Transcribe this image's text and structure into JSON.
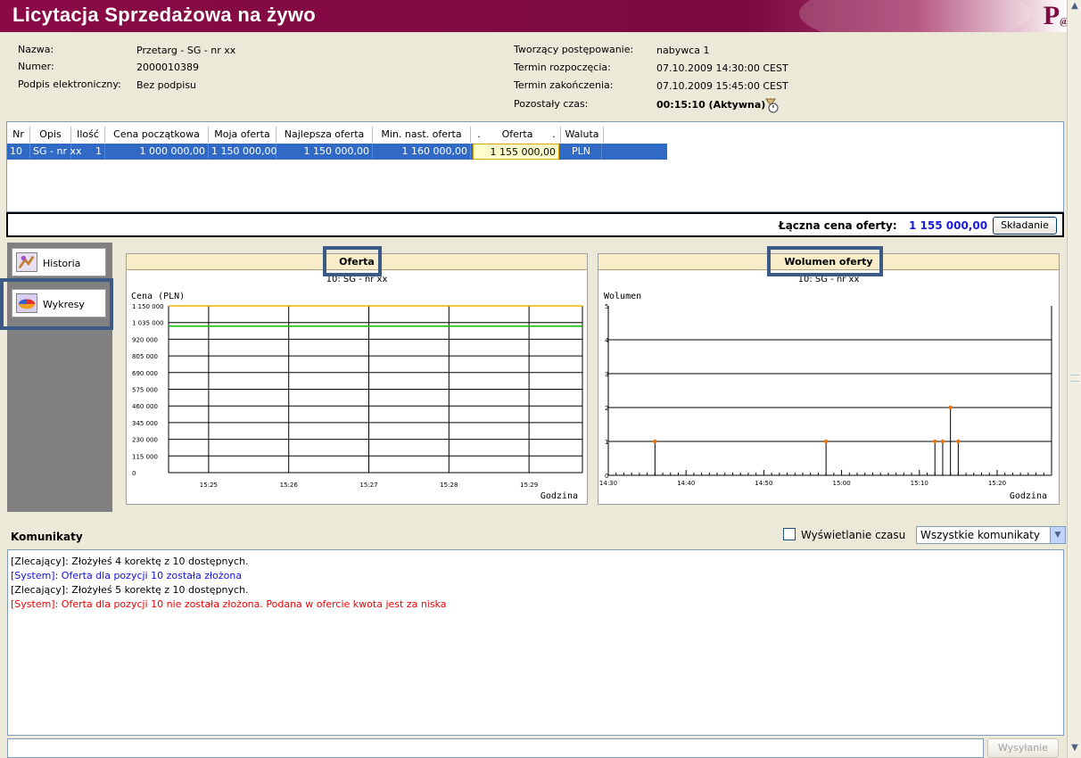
{
  "app": {
    "title": "Licytacja Sprzedażowa na żywo"
  },
  "info": {
    "nazwa_label": "Nazwa:",
    "nazwa_value": "Przetarg - SG - nr xx",
    "numer_label": "Numer:",
    "numer_value": "2000010389",
    "podpis_label": "Podpis elektroniczny:",
    "podpis_value": "Bez podpisu",
    "tworzacy_label": "Tworzący postępowanie:",
    "tworzacy_value": "nabywca 1",
    "start_label": "Termin rozpoczęcia:",
    "start_value": "07.10.2009 14:30:00 CEST",
    "end_label": "Termin zakończenia:",
    "end_value": "07.10.2009 15:45:00 CEST",
    "remaining_label": "Pozostały czas:",
    "remaining_value": "00:15:10 (Aktywna)"
  },
  "table": {
    "columns": [
      "Nr",
      "Opis",
      "Ilość",
      "Cena początkowa",
      "Moja oferta",
      "Najlepsza oferta",
      "Min. nast. oferta",
      ".",
      "Oferta",
      ".",
      "Waluta"
    ],
    "row": {
      "nr": "10",
      "opis": "SG - nr xx",
      "ilosc": "1",
      "cena_poczatkowa": "1 000 000,00",
      "moja_oferta": "1 150 000,00",
      "najlepsza_oferta": "1 150 000,00",
      "min_nast_oferta": "1 160 000,00",
      "oferta": "1 155 000,00",
      "waluta": "PLN"
    }
  },
  "total": {
    "label": "Łączna cena oferty:",
    "value": "1 155 000,00",
    "submit_label": "Składanie"
  },
  "side_tabs": {
    "historia": "Historia",
    "wykresy": "Wykresy"
  },
  "chart_oferta": {
    "title": "Oferta",
    "subtitle": "10: SG - nr xx",
    "ylabel": "Cena (PLN)",
    "xlabel": "Godzina",
    "yticks": [
      "1 150 000",
      "1 035 000",
      "920 000",
      "805 000",
      "690 000",
      "575 000",
      "460 000",
      "345 000",
      "230 000",
      "115 000",
      "0"
    ],
    "xticks": [
      "15:25",
      "15:26",
      "15:27",
      "15:28",
      "15:29"
    ]
  },
  "chart_wolumen": {
    "title": "Wolumen oferty",
    "subtitle": "10: SG - nr xx",
    "ylabel": "Wolumen",
    "xlabel": "Godzina",
    "yticks": [
      "5",
      "4",
      "3",
      "2",
      "1",
      "0"
    ],
    "xticks": [
      "14:30",
      "14:40",
      "14:50",
      "15:00",
      "15:10",
      "15:20"
    ]
  },
  "chart_data": [
    {
      "type": "line",
      "title": "Oferta",
      "xlabel": "Godzina",
      "ylabel": "Cena (PLN)",
      "ylim": [
        0,
        1150000
      ],
      "xlim": [
        "15:24:30",
        "15:29:40"
      ],
      "series": [
        {
          "values": [
            [
              "15:24:30",
              1150000
            ],
            [
              "15:29:40",
              1150000
            ]
          ],
          "color": "#f0b000"
        },
        {
          "values": [
            [
              "15:24:30",
              1010000
            ],
            [
              "15:29:40",
              1010000
            ]
          ],
          "color": "#00c000"
        }
      ],
      "grid": true
    },
    {
      "type": "scatter",
      "title": "Wolumen oferty",
      "xlabel": "Godzina",
      "ylabel": "Wolumen",
      "ylim": [
        0,
        5
      ],
      "xlim": [
        "14:30",
        "15:27"
      ],
      "points": [
        {
          "x": "14:36",
          "y": 1
        },
        {
          "x": "14:58",
          "y": 1
        },
        {
          "x": "15:12",
          "y": 1
        },
        {
          "x": "15:13",
          "y": 1
        },
        {
          "x": "15:14",
          "y": 2
        },
        {
          "x": "15:15",
          "y": 1
        }
      ],
      "point_color": "#f07000",
      "grid": true
    }
  ],
  "messages": {
    "header": "Komunikaty",
    "time_toggle_label": "Wyświetlanie czasu",
    "filter_value": "Wszystkie komunikaty",
    "send_label": "Wysyłanie",
    "items": [
      {
        "text": "[Zlecający]: Złożyłeś 4 korektę z 10 dostępnych.",
        "color": "#000000"
      },
      {
        "text": "[System]:  Oferta dla pozycji 10 została złożona",
        "color": "#1010e0"
      },
      {
        "text": "[Zlecający]: Złożyłeś 5 korektę z 10 dostępnych.",
        "color": "#000000"
      },
      {
        "text": "[System]:  Oferta dla pozycji 10 nie została złożona. Podana w ofercie kwota jest za niska",
        "color": "#ee0000"
      }
    ]
  }
}
